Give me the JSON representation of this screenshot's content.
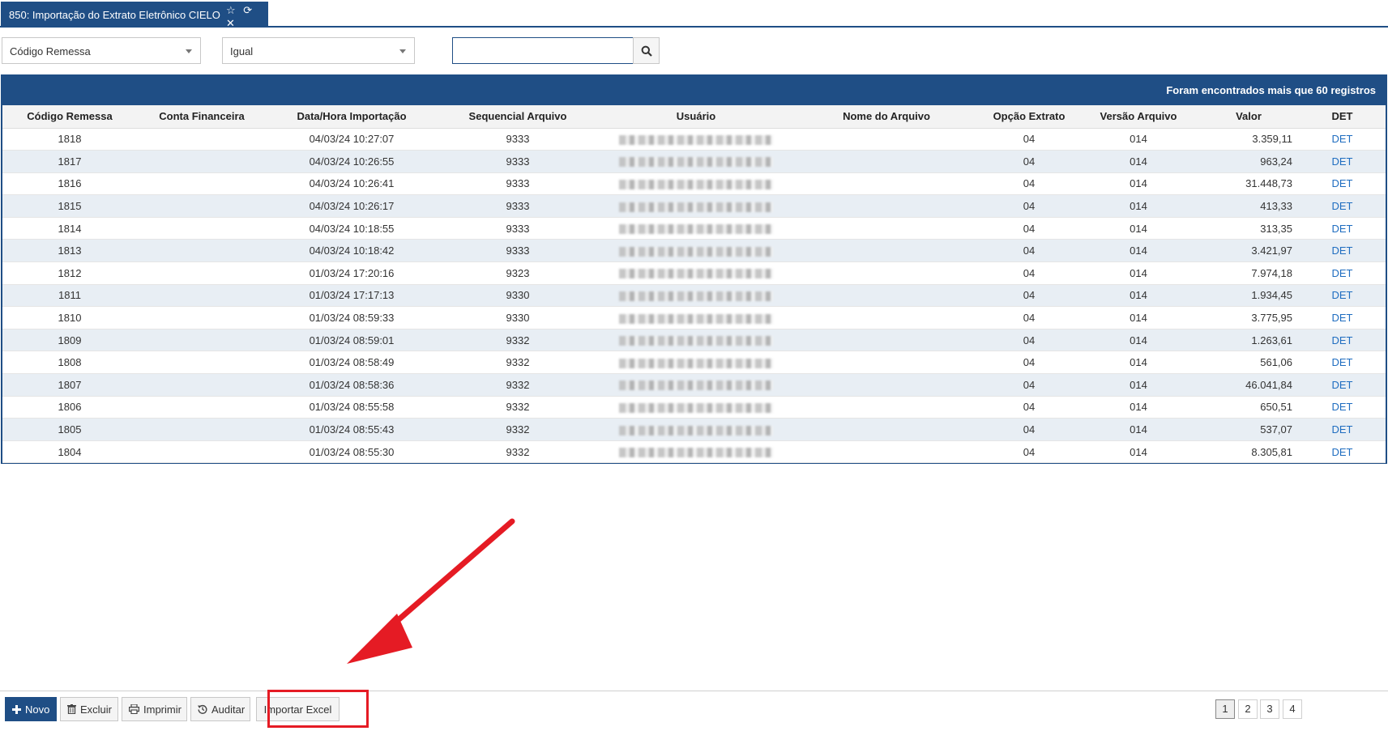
{
  "tab": {
    "title": "850: Importação do Extrato Eletrônico CIELO"
  },
  "filter": {
    "field_value": "Código Remessa",
    "operator_value": "Igual",
    "search_value": "",
    "search_placeholder": ""
  },
  "grid": {
    "header_message": "Foram encontrados mais que 60 registros",
    "columns": [
      "Código Remessa",
      "Conta Financeira",
      "Data/Hora Importação",
      "Sequencial Arquivo",
      "Usuário",
      "Nome do Arquivo",
      "Opção Extrato",
      "Versão Arquivo",
      "Valor",
      "DET"
    ],
    "rows": [
      {
        "codigo": "1818",
        "conta": "",
        "datahora": "04/03/24 10:27:07",
        "sequencial": "9333",
        "usuario": "",
        "arquivo": "",
        "opcao": "04",
        "versao": "014",
        "valor": "3.359,11",
        "det": "DET"
      },
      {
        "codigo": "1817",
        "conta": "",
        "datahora": "04/03/24 10:26:55",
        "sequencial": "9333",
        "usuario": "",
        "arquivo": "",
        "opcao": "04",
        "versao": "014",
        "valor": "963,24",
        "det": "DET"
      },
      {
        "codigo": "1816",
        "conta": "",
        "datahora": "04/03/24 10:26:41",
        "sequencial": "9333",
        "usuario": "",
        "arquivo": "",
        "opcao": "04",
        "versao": "014",
        "valor": "31.448,73",
        "det": "DET"
      },
      {
        "codigo": "1815",
        "conta": "",
        "datahora": "04/03/24 10:26:17",
        "sequencial": "9333",
        "usuario": "",
        "arquivo": "",
        "opcao": "04",
        "versao": "014",
        "valor": "413,33",
        "det": "DET"
      },
      {
        "codigo": "1814",
        "conta": "",
        "datahora": "04/03/24 10:18:55",
        "sequencial": "9333",
        "usuario": "",
        "arquivo": "",
        "opcao": "04",
        "versao": "014",
        "valor": "313,35",
        "det": "DET"
      },
      {
        "codigo": "1813",
        "conta": "",
        "datahora": "04/03/24 10:18:42",
        "sequencial": "9333",
        "usuario": "",
        "arquivo": "",
        "opcao": "04",
        "versao": "014",
        "valor": "3.421,97",
        "det": "DET"
      },
      {
        "codigo": "1812",
        "conta": "",
        "datahora": "01/03/24 17:20:16",
        "sequencial": "9323",
        "usuario": "",
        "arquivo": "",
        "opcao": "04",
        "versao": "014",
        "valor": "7.974,18",
        "det": "DET"
      },
      {
        "codigo": "1811",
        "conta": "",
        "datahora": "01/03/24 17:17:13",
        "sequencial": "9330",
        "usuario": "",
        "arquivo": "",
        "opcao": "04",
        "versao": "014",
        "valor": "1.934,45",
        "det": "DET"
      },
      {
        "codigo": "1810",
        "conta": "",
        "datahora": "01/03/24 08:59:33",
        "sequencial": "9330",
        "usuario": "",
        "arquivo": "",
        "opcao": "04",
        "versao": "014",
        "valor": "3.775,95",
        "det": "DET"
      },
      {
        "codigo": "1809",
        "conta": "",
        "datahora": "01/03/24 08:59:01",
        "sequencial": "9332",
        "usuario": "",
        "arquivo": "",
        "opcao": "04",
        "versao": "014",
        "valor": "1.263,61",
        "det": "DET"
      },
      {
        "codigo": "1808",
        "conta": "",
        "datahora": "01/03/24 08:58:49",
        "sequencial": "9332",
        "usuario": "",
        "arquivo": "",
        "opcao": "04",
        "versao": "014",
        "valor": "561,06",
        "det": "DET"
      },
      {
        "codigo": "1807",
        "conta": "",
        "datahora": "01/03/24 08:58:36",
        "sequencial": "9332",
        "usuario": "",
        "arquivo": "",
        "opcao": "04",
        "versao": "014",
        "valor": "46.041,84",
        "det": "DET"
      },
      {
        "codigo": "1806",
        "conta": "",
        "datahora": "01/03/24 08:55:58",
        "sequencial": "9332",
        "usuario": "",
        "arquivo": "",
        "opcao": "04",
        "versao": "014",
        "valor": "650,51",
        "det": "DET"
      },
      {
        "codigo": "1805",
        "conta": "",
        "datahora": "01/03/24 08:55:43",
        "sequencial": "9332",
        "usuario": "",
        "arquivo": "",
        "opcao": "04",
        "versao": "014",
        "valor": "537,07",
        "det": "DET"
      },
      {
        "codigo": "1804",
        "conta": "",
        "datahora": "01/03/24 08:55:30",
        "sequencial": "9332",
        "usuario": "",
        "arquivo": "",
        "opcao": "04",
        "versao": "014",
        "valor": "8.305,81",
        "det": "DET"
      }
    ]
  },
  "toolbar": {
    "novo_label": "Novo",
    "excluir_label": "Excluir",
    "imprimir_label": "Imprimir",
    "auditar_label": "Auditar",
    "importar_label": "Importar Excel"
  },
  "pagination": {
    "pages": [
      "1",
      "2",
      "3",
      "4"
    ],
    "current": "1"
  },
  "colors": {
    "brand": "#1f4e85",
    "link": "#1f6dc0",
    "highlight": "#e51b24",
    "row_alt": "#e8eef4"
  },
  "icons": {
    "tab": [
      "star-icon",
      "refresh-icon",
      "close-icon"
    ],
    "search": "search-icon",
    "novo": "plus-icon",
    "excluir": "trash-icon",
    "imprimir": "print-icon",
    "auditar": "history-icon"
  }
}
